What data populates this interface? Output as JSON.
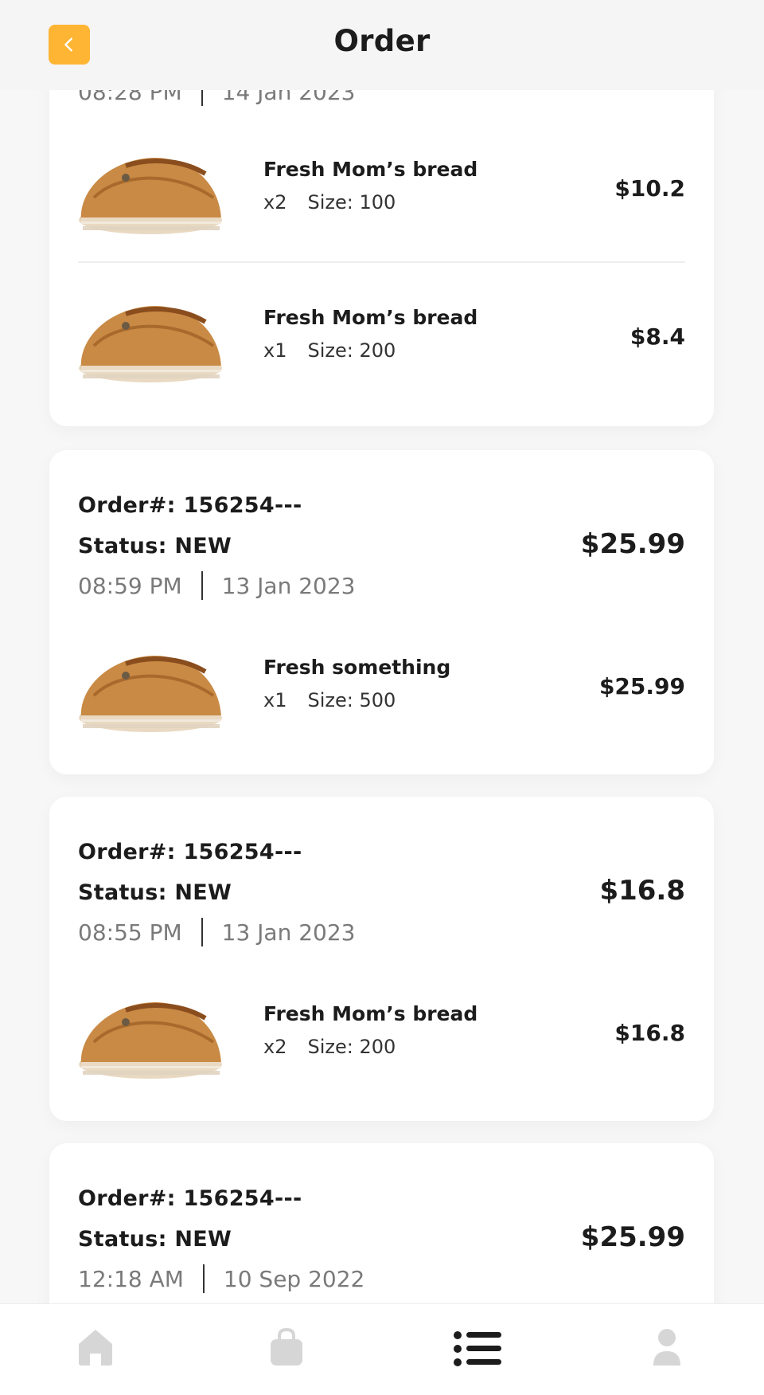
{
  "header": {
    "title": "Order",
    "back_icon": "chevron-left-icon",
    "accent": "#ffb534"
  },
  "orders": [
    {
      "total": "",
      "time": "08:28 PM",
      "date": "14 Jan 2023",
      "items": [
        {
          "name": "Fresh Mom’s bread",
          "qty": "x2",
          "size": "Size: 100",
          "price": "$10.2"
        },
        {
          "name": "Fresh Mom’s bread",
          "qty": "x1",
          "size": "Size: 200",
          "price": "$8.4"
        }
      ]
    },
    {
      "order_no": "Order#: 156254---",
      "status": "Status: NEW",
      "total": "$25.99",
      "time": "08:59 PM",
      "date": "13 Jan 2023",
      "items": [
        {
          "name": "Fresh something",
          "qty": "x1",
          "size": "Size: 500",
          "price": "$25.99"
        }
      ]
    },
    {
      "order_no": "Order#: 156254---",
      "status": "Status: NEW",
      "total": "$16.8",
      "time": "08:55 PM",
      "date": "13 Jan 2023",
      "items": [
        {
          "name": "Fresh Mom’s bread",
          "qty": "x2",
          "size": "Size: 200",
          "price": "$16.8"
        }
      ]
    },
    {
      "order_no": "Order#: 156254---",
      "status": "Status: NEW",
      "total": "$25.99",
      "time": "12:18 AM",
      "date": "10 Sep 2022",
      "items": []
    }
  ],
  "nav": {
    "items": [
      {
        "icon": "home-icon",
        "active": false
      },
      {
        "icon": "shopping-bag-icon",
        "active": false
      },
      {
        "icon": "list-icon",
        "active": true
      },
      {
        "icon": "profile-icon",
        "active": false
      }
    ],
    "active_color": "#1c1c1c",
    "inactive_color": "#d6d6d6"
  }
}
